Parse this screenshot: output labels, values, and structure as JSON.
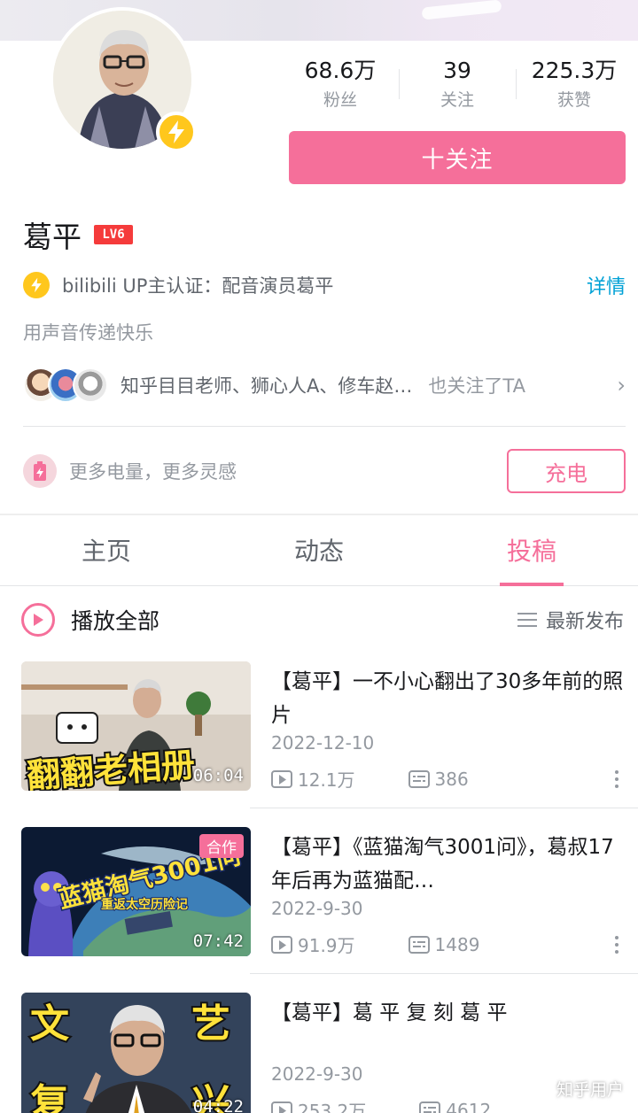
{
  "profile": {
    "name": "葛平",
    "level": "LV6",
    "stats": [
      {
        "value": "68.6万",
        "label": "粉丝"
      },
      {
        "value": "39",
        "label": "关注"
      },
      {
        "value": "225.3万",
        "label": "获赞"
      }
    ],
    "follow_label": "十关注",
    "certification": "bilibili UP主认证：配音演员葛平",
    "cert_detail": "详情",
    "signature": "用声音传递快乐",
    "mutual_names": "知乎目目老师、狮心人A、修车赵…",
    "mutual_suffix": "也关注了TA",
    "charge_text": "更多电量，更多灵感",
    "charge_button": "充电"
  },
  "tabs": [
    {
      "label": "主页",
      "active": false
    },
    {
      "label": "动态",
      "active": false
    },
    {
      "label": "投稿",
      "active": true
    }
  ],
  "list_header": {
    "play_all": "播放全部",
    "sort": "最新发布"
  },
  "videos": [
    {
      "title": "【葛平】一不小心翻出了30多年前的照片",
      "date": "2022-12-10",
      "views": "12.1万",
      "danmaku": "386",
      "duration": "06:04",
      "thumb_text": "翻翻老相册",
      "badge": ""
    },
    {
      "title": "【葛平】《蓝猫淘气3001问》，葛叔17年后再为蓝猫配…",
      "date": "2022-9-30",
      "views": "91.9万",
      "danmaku": "1489",
      "duration": "07:42",
      "thumb_text": "蓝猫淘气3001问",
      "thumb_sub": "重返太空历险记",
      "badge": "合作"
    },
    {
      "title": "【葛平】葛 平 复 刻 葛 平",
      "date": "2022-9-30",
      "views": "253.2万",
      "danmaku": "4612",
      "duration": "04:22",
      "thumb_text_left": "文",
      "thumb_text_left2": "复",
      "thumb_text_right": "艺",
      "thumb_text_right2": "兴",
      "badge": ""
    }
  ],
  "watermark": "知乎用户",
  "colors": {
    "accent": "#f56f9a",
    "link": "#00a1d6",
    "gold": "#ffc71d"
  }
}
